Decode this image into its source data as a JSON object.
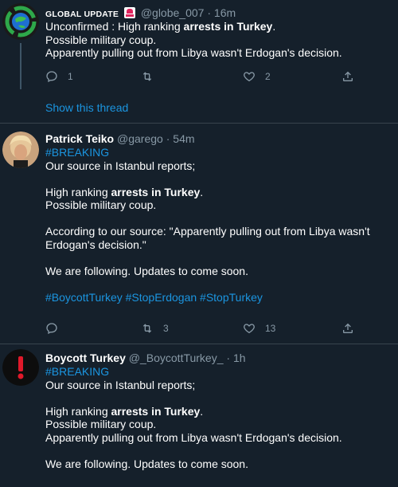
{
  "tweets": [
    {
      "name": "GLOBAL UPDATE",
      "flag_icon": "siren-emoji",
      "handle": "@globe_007",
      "dot": "·",
      "time": "16m",
      "text": {
        "line1_pre": "Unconfirmed : High ranking ",
        "line1_bold": "arrests in Turkey",
        "line1_post": ".",
        "line2": "Possible military coup.",
        "line3": "Apparently pulling out from Libya wasn't Erdogan's decision."
      },
      "replies": "1",
      "retweets": "",
      "likes": "2",
      "show_thread": "Show this thread"
    },
    {
      "name": "Patrick Teiko",
      "handle": "@garego",
      "dot": "·",
      "time": "54m",
      "text": {
        "tag": "#BREAKING",
        "line1": "Our source in Istanbul reports;",
        "line2_pre": "High ranking ",
        "line2_bold": "arrests in Turkey",
        "line2_post": ".",
        "line3": "Possible military coup.",
        "line4": "According to our source: \"Apparently pulling out from Libya wasn't",
        "line5": "Erdogan's decision.\"",
        "line6": "We are following. Updates to come soon.",
        "hashtags": "#BoycottTurkey #StopErdogan #StopTurkey"
      },
      "replies": "",
      "retweets": "3",
      "likes": "13"
    },
    {
      "name": "Boycott Turkey",
      "handle": "@_BoycottTurkey_",
      "dot": "·",
      "time": "1h",
      "text": {
        "tag": "#BREAKING",
        "line1": "Our source in Istanbul reports;",
        "line2_pre": "High ranking ",
        "line2_bold": "arrests in Turkey",
        "line2_post": ".",
        "line3": "Possible military coup.",
        "line4": "Apparently pulling out from Libya wasn't Erdogan's decision.",
        "line5": "We are following. Updates to come soon."
      }
    }
  ],
  "colors": {
    "background": "#15202b",
    "link": "#1b95e0",
    "muted": "#8899a6",
    "separator": "#38444d"
  }
}
